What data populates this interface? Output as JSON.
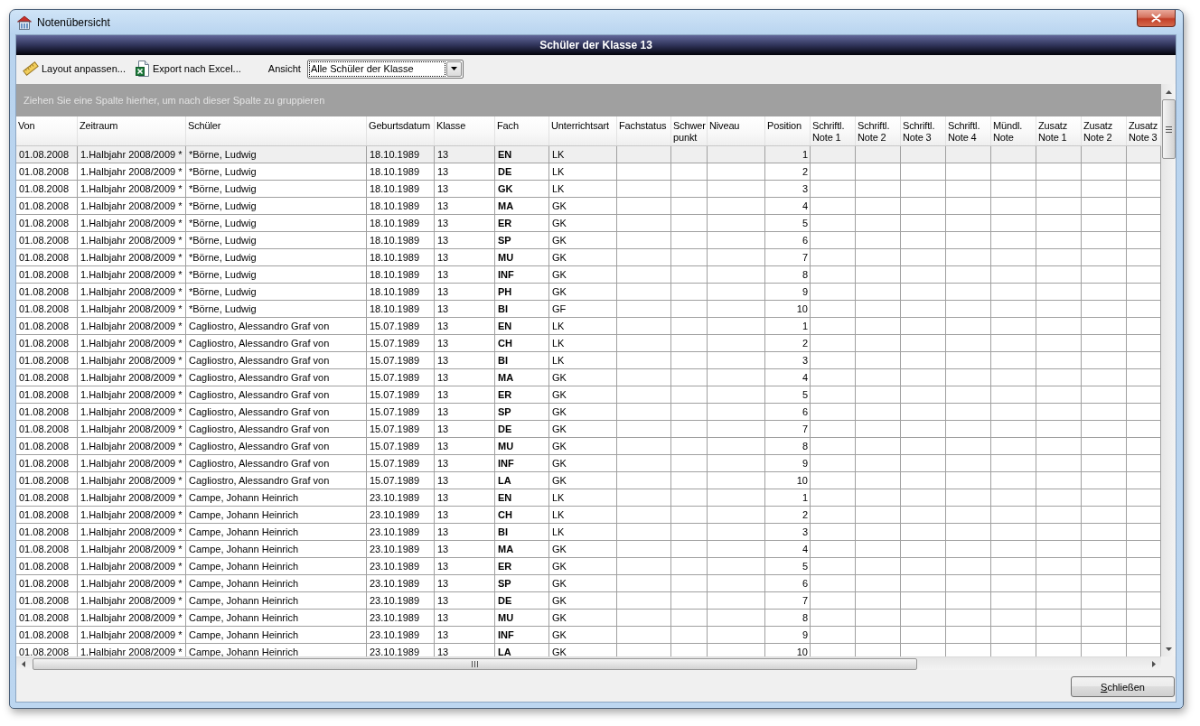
{
  "window": {
    "title": "Notenübersicht"
  },
  "banner": {
    "title": "Schüler der Klasse 13"
  },
  "toolbar": {
    "buttons": [
      {
        "label": "Layout anpassen..."
      },
      {
        "label": "Export nach Excel..."
      }
    ],
    "view": {
      "label": "Ansicht",
      "value": "Alle Schüler der Klasse",
      "focused": true
    }
  },
  "grid": {
    "group_hint": "Ziehen Sie eine Spalte hierher, um nach dieser Spalte zu gruppieren",
    "columns": [
      {
        "label": "Von",
        "kind": "text"
      },
      {
        "label": "Zeitraum",
        "kind": "text"
      },
      {
        "label": "Schüler",
        "kind": "text"
      },
      {
        "label": "Geburtsdatum",
        "kind": "text"
      },
      {
        "label": "Klasse",
        "kind": "text"
      },
      {
        "label": "Fach",
        "kind": "bold"
      },
      {
        "label": "Unterrichtsart",
        "kind": "text"
      },
      {
        "label": "Fachstatus",
        "kind": "empty"
      },
      {
        "label": "Schwerpunkt",
        "kind": "empty"
      },
      {
        "label": "Niveau",
        "kind": "empty"
      },
      {
        "label": "Position",
        "kind": "number"
      },
      {
        "label": "Schriftl. Note 1",
        "kind": "empty"
      },
      {
        "label": "Schriftl. Note 2",
        "kind": "empty"
      },
      {
        "label": "Schriftl. Note 3",
        "kind": "empty"
      },
      {
        "label": "Schriftl. Note 4",
        "kind": "empty"
      },
      {
        "label": "Mündl. Note",
        "kind": "empty"
      },
      {
        "label": "Zusatz Note 1",
        "kind": "empty"
      },
      {
        "label": "Zusatz Note 2",
        "kind": "empty"
      },
      {
        "label": "Zusatz Note 3",
        "kind": "empty"
      }
    ],
    "rows": [
      {
        "selected": true,
        "cells": [
          "01.08.2008",
          "1.Halbjahr 2008/2009 *",
          "*Börne, Ludwig",
          "18.10.1989",
          "13",
          "EN",
          "LK",
          "1"
        ]
      },
      {
        "selected": false,
        "cells": [
          "01.08.2008",
          "1.Halbjahr 2008/2009 *",
          "*Börne, Ludwig",
          "18.10.1989",
          "13",
          "DE",
          "LK",
          "2"
        ]
      },
      {
        "selected": false,
        "cells": [
          "01.08.2008",
          "1.Halbjahr 2008/2009 *",
          "*Börne, Ludwig",
          "18.10.1989",
          "13",
          "GK",
          "LK",
          "3"
        ]
      },
      {
        "selected": false,
        "cells": [
          "01.08.2008",
          "1.Halbjahr 2008/2009 *",
          "*Börne, Ludwig",
          "18.10.1989",
          "13",
          "MA",
          "GK",
          "4"
        ]
      },
      {
        "selected": false,
        "cells": [
          "01.08.2008",
          "1.Halbjahr 2008/2009 *",
          "*Börne, Ludwig",
          "18.10.1989",
          "13",
          "ER",
          "GK",
          "5"
        ]
      },
      {
        "selected": false,
        "cells": [
          "01.08.2008",
          "1.Halbjahr 2008/2009 *",
          "*Börne, Ludwig",
          "18.10.1989",
          "13",
          "SP",
          "GK",
          "6"
        ]
      },
      {
        "selected": false,
        "cells": [
          "01.08.2008",
          "1.Halbjahr 2008/2009 *",
          "*Börne, Ludwig",
          "18.10.1989",
          "13",
          "MU",
          "GK",
          "7"
        ]
      },
      {
        "selected": false,
        "cells": [
          "01.08.2008",
          "1.Halbjahr 2008/2009 *",
          "*Börne, Ludwig",
          "18.10.1989",
          "13",
          "INF",
          "GK",
          "8"
        ]
      },
      {
        "selected": false,
        "cells": [
          "01.08.2008",
          "1.Halbjahr 2008/2009 *",
          "*Börne, Ludwig",
          "18.10.1989",
          "13",
          "PH",
          "GK",
          "9"
        ]
      },
      {
        "selected": false,
        "cells": [
          "01.08.2008",
          "1.Halbjahr 2008/2009 *",
          "*Börne, Ludwig",
          "18.10.1989",
          "13",
          "BI",
          "GF",
          "10"
        ]
      },
      {
        "selected": false,
        "cells": [
          "01.08.2008",
          "1.Halbjahr 2008/2009 *",
          "Cagliostro, Alessandro Graf von",
          "15.07.1989",
          "13",
          "EN",
          "LK",
          "1"
        ]
      },
      {
        "selected": false,
        "cells": [
          "01.08.2008",
          "1.Halbjahr 2008/2009 *",
          "Cagliostro, Alessandro Graf von",
          "15.07.1989",
          "13",
          "CH",
          "LK",
          "2"
        ]
      },
      {
        "selected": false,
        "cells": [
          "01.08.2008",
          "1.Halbjahr 2008/2009 *",
          "Cagliostro, Alessandro Graf von",
          "15.07.1989",
          "13",
          "BI",
          "LK",
          "3"
        ]
      },
      {
        "selected": false,
        "cells": [
          "01.08.2008",
          "1.Halbjahr 2008/2009 *",
          "Cagliostro, Alessandro Graf von",
          "15.07.1989",
          "13",
          "MA",
          "GK",
          "4"
        ]
      },
      {
        "selected": false,
        "cells": [
          "01.08.2008",
          "1.Halbjahr 2008/2009 *",
          "Cagliostro, Alessandro Graf von",
          "15.07.1989",
          "13",
          "ER",
          "GK",
          "5"
        ]
      },
      {
        "selected": false,
        "cells": [
          "01.08.2008",
          "1.Halbjahr 2008/2009 *",
          "Cagliostro, Alessandro Graf von",
          "15.07.1989",
          "13",
          "SP",
          "GK",
          "6"
        ]
      },
      {
        "selected": false,
        "cells": [
          "01.08.2008",
          "1.Halbjahr 2008/2009 *",
          "Cagliostro, Alessandro Graf von",
          "15.07.1989",
          "13",
          "DE",
          "GK",
          "7"
        ]
      },
      {
        "selected": false,
        "cells": [
          "01.08.2008",
          "1.Halbjahr 2008/2009 *",
          "Cagliostro, Alessandro Graf von",
          "15.07.1989",
          "13",
          "MU",
          "GK",
          "8"
        ]
      },
      {
        "selected": false,
        "cells": [
          "01.08.2008",
          "1.Halbjahr 2008/2009 *",
          "Cagliostro, Alessandro Graf von",
          "15.07.1989",
          "13",
          "INF",
          "GK",
          "9"
        ]
      },
      {
        "selected": false,
        "cells": [
          "01.08.2008",
          "1.Halbjahr 2008/2009 *",
          "Cagliostro, Alessandro Graf von",
          "15.07.1989",
          "13",
          "LA",
          "GK",
          "10"
        ]
      },
      {
        "selected": false,
        "cells": [
          "01.08.2008",
          "1.Halbjahr 2008/2009 *",
          "Campe, Johann Heinrich",
          "23.10.1989",
          "13",
          "EN",
          "LK",
          "1"
        ]
      },
      {
        "selected": false,
        "cells": [
          "01.08.2008",
          "1.Halbjahr 2008/2009 *",
          "Campe, Johann Heinrich",
          "23.10.1989",
          "13",
          "CH",
          "LK",
          "2"
        ]
      },
      {
        "selected": false,
        "cells": [
          "01.08.2008",
          "1.Halbjahr 2008/2009 *",
          "Campe, Johann Heinrich",
          "23.10.1989",
          "13",
          "BI",
          "LK",
          "3"
        ]
      },
      {
        "selected": false,
        "cells": [
          "01.08.2008",
          "1.Halbjahr 2008/2009 *",
          "Campe, Johann Heinrich",
          "23.10.1989",
          "13",
          "MA",
          "GK",
          "4"
        ]
      },
      {
        "selected": false,
        "cells": [
          "01.08.2008",
          "1.Halbjahr 2008/2009 *",
          "Campe, Johann Heinrich",
          "23.10.1989",
          "13",
          "ER",
          "GK",
          "5"
        ]
      },
      {
        "selected": false,
        "cells": [
          "01.08.2008",
          "1.Halbjahr 2008/2009 *",
          "Campe, Johann Heinrich",
          "23.10.1989",
          "13",
          "SP",
          "GK",
          "6"
        ]
      },
      {
        "selected": false,
        "cells": [
          "01.08.2008",
          "1.Halbjahr 2008/2009 *",
          "Campe, Johann Heinrich",
          "23.10.1989",
          "13",
          "DE",
          "GK",
          "7"
        ]
      },
      {
        "selected": false,
        "cells": [
          "01.08.2008",
          "1.Halbjahr 2008/2009 *",
          "Campe, Johann Heinrich",
          "23.10.1989",
          "13",
          "MU",
          "GK",
          "8"
        ]
      },
      {
        "selected": false,
        "cells": [
          "01.08.2008",
          "1.Halbjahr 2008/2009 *",
          "Campe, Johann Heinrich",
          "23.10.1989",
          "13",
          "INF",
          "GK",
          "9"
        ]
      },
      {
        "selected": false,
        "cells": [
          "01.08.2008",
          "1.Halbjahr 2008/2009 *",
          "Campe, Johann Heinrich",
          "23.10.1989",
          "13",
          "LA",
          "GK",
          "10"
        ]
      }
    ]
  },
  "footer": {
    "buttons": [
      {
        "label": "Schließen",
        "mnemonic": true
      }
    ]
  }
}
